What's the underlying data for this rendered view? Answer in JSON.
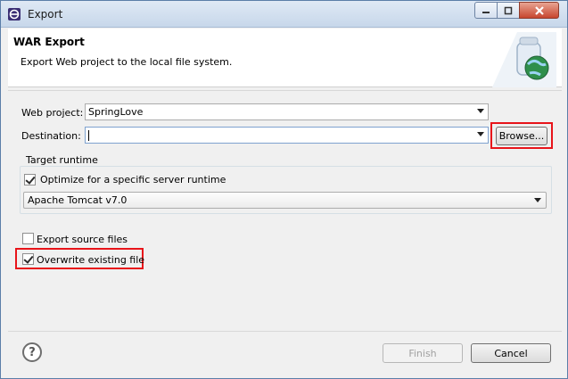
{
  "window": {
    "title": "Export"
  },
  "header": {
    "title": "WAR Export",
    "description": "Export Web project to the local file system.",
    "icon": "war-export-icon"
  },
  "form": {
    "web_project_label": "Web project:",
    "web_project_value": "SpringLove",
    "destination_label": "Destination:",
    "destination_value": "",
    "browse_label": "Browse..."
  },
  "target_runtime": {
    "group_title": "Target runtime",
    "optimize_label": "Optimize for a specific server runtime",
    "optimize_checked": true,
    "runtime_value": "Apache Tomcat v7.0"
  },
  "options": {
    "export_source_label": "Export source files",
    "export_source_checked": false,
    "overwrite_label": "Overwrite existing file",
    "overwrite_checked": true
  },
  "footer": {
    "help_icon": "help-icon",
    "finish_label": "Finish",
    "cancel_label": "Cancel"
  },
  "colors": {
    "highlight": "#e8141a",
    "title_bar": "#c7d7ea"
  }
}
